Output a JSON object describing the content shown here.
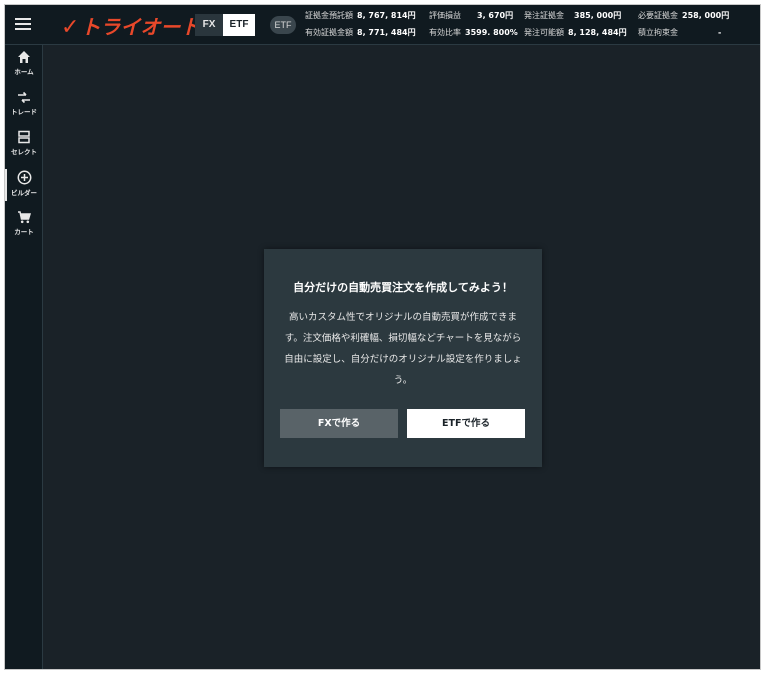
{
  "header": {
    "logo_text": "トライオート",
    "logo_mark": "✓",
    "mode_tabs": [
      {
        "label": "FX",
        "active": false
      },
      {
        "label": "ETF",
        "active": true
      }
    ],
    "etf_badge": "ETF",
    "stats_row1": [
      {
        "label": "証拠金預託額",
        "value": "8, 767, 814円"
      },
      {
        "label": "評価損益",
        "value": "3, 670円"
      },
      {
        "label": "発注証拠金",
        "value": "385, 000円"
      },
      {
        "label": "必要証拠金",
        "value": "258, 000円"
      }
    ],
    "stats_row2": [
      {
        "label": "有効証拠金額",
        "value": "8, 771, 484円"
      },
      {
        "label": "有効比率",
        "value": "3599. 800%"
      },
      {
        "label": "発注可能額",
        "value": "8, 128, 484円"
      },
      {
        "label": "積立拘束金",
        "value": "-"
      }
    ]
  },
  "sidebar": {
    "items": [
      {
        "icon": "home-icon",
        "label": "ホーム",
        "active": false
      },
      {
        "icon": "trade-icon",
        "label": "トレード",
        "active": false
      },
      {
        "icon": "select-icon",
        "label": "セレクト",
        "active": false
      },
      {
        "icon": "plus-circle-icon",
        "label": "ビルダー",
        "active": true
      },
      {
        "icon": "cart-icon",
        "label": "カート",
        "active": false
      }
    ]
  },
  "dialog": {
    "title": "自分だけの自動売買注文を作成してみよう！",
    "body": "高いカスタム性でオリジナルの自動売買が作成できます。注文価格や利確幅、損切幅などチャートを見ながら自由に設定し、自分だけのオリジナル設定を作りましょう。",
    "fx_button": "FXで作る",
    "etf_button": "ETFで作る"
  },
  "colors": {
    "background": "#1a2228",
    "sidebar": "#101a20",
    "dialog": "#2c393f",
    "brand": "#e8482a",
    "fx_button": "#596368",
    "etf_button": "#ffffff"
  }
}
